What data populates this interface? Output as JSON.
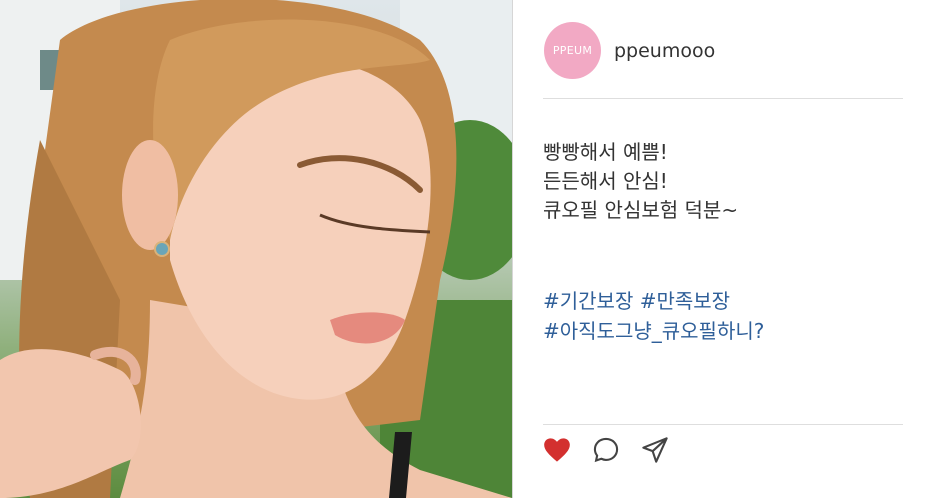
{
  "post": {
    "account": {
      "avatar_text": "PPEUM",
      "username": "ppeumooo"
    },
    "caption_lines": [
      "빵빵해서 예쁨!",
      "든든해서 안심!",
      "큐오필 안심보험 덕분~"
    ],
    "hashtag_lines": [
      "#기간보장 #만족보장",
      "#아직도그냥_큐오필하니?"
    ],
    "actions": [
      "heart-icon",
      "comment-icon",
      "share-icon"
    ],
    "colors": {
      "avatar": "#f2a9c4",
      "hashtag": "#2f5f99",
      "like": "#d3302f",
      "text": "#333333"
    }
  }
}
